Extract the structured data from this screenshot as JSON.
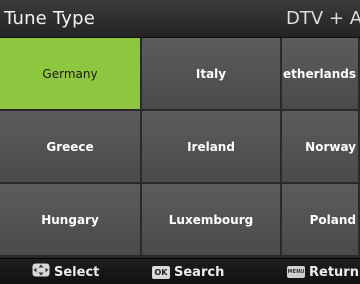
{
  "header": {
    "title": "Tune Type",
    "mode": "DTV + ATV"
  },
  "grid": {
    "selected_index": 0,
    "rows": [
      [
        "Germany",
        "Italy",
        "Netherlands"
      ],
      [
        "Greece",
        "Ireland",
        "Norway"
      ],
      [
        "Hungary",
        "Luxembourg",
        "Poland"
      ]
    ]
  },
  "footer": {
    "select_label": "Select",
    "search_label": "Search",
    "return_label": "Return",
    "ok_key_label": "OK",
    "menu_key_label": "MENU"
  },
  "colors": {
    "selected_cell": "#8ec63f",
    "cell": "#555555",
    "background": "#2a2a2a"
  },
  "icons": {
    "select": "arrow-pad-icon",
    "search": "ok-key-icon",
    "return": "menu-key-icon"
  }
}
